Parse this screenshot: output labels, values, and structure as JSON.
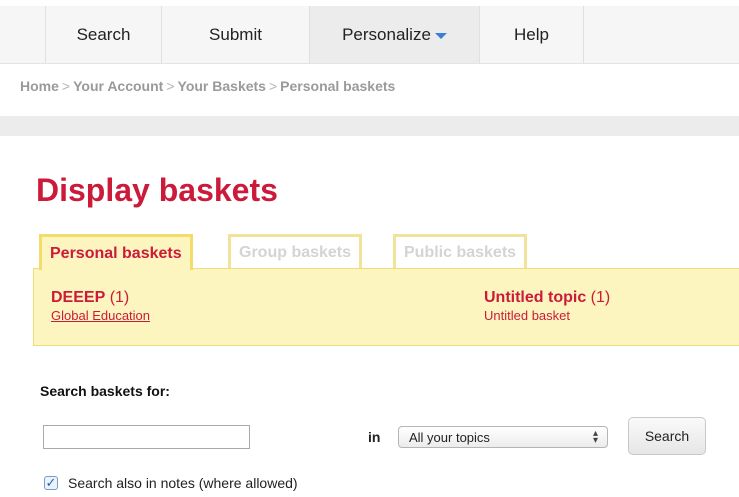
{
  "nav": {
    "search": "Search",
    "submit": "Submit",
    "personalize": "Personalize",
    "help": "Help"
  },
  "breadcrumb": [
    "Home",
    "Your Account",
    "Your Baskets",
    "Personal baskets"
  ],
  "breadcrumb_separator": ">",
  "page_title": "Display baskets",
  "tabs": {
    "personal": "Personal baskets",
    "group": "Group baskets",
    "public": "Public baskets"
  },
  "topics": [
    {
      "name": "DEEEP",
      "count": "(1)",
      "basket": "Global Education"
    },
    {
      "name": "Untitled topic",
      "count": "(1)",
      "basket": "Untitled basket"
    }
  ],
  "search": {
    "heading": "Search baskets for:",
    "input_value": "",
    "in_label": "in",
    "scope_selected": "All your topics",
    "button_label": "Search",
    "notes_checked": true,
    "notes_label": "Search also in notes (where allowed)"
  },
  "colors": {
    "accent": "#cc1a3a",
    "panel": "#fdf5bf",
    "tab_border": "#f4dc6a",
    "checkmark": "#2a5ea8"
  },
  "icons": {
    "dropdown": "chevron-down-icon",
    "select_arrows": "up-down-arrows-icon",
    "check": "checkmark-icon"
  }
}
